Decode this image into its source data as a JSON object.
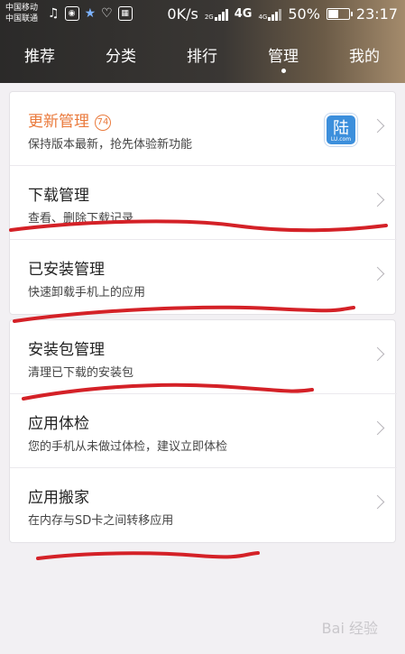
{
  "status_bar": {
    "carrier1": "中国移动",
    "carrier2": "中国联通",
    "network_speed": "0K/s",
    "net_2g": "2G",
    "net_4g": "4G",
    "net_4g_small": "4G",
    "battery": "50%",
    "time": "23:17"
  },
  "tabs": [
    {
      "label": "推荐"
    },
    {
      "label": "分类"
    },
    {
      "label": "排行"
    },
    {
      "label": "管理"
    },
    {
      "label": "我的"
    }
  ],
  "cards": [
    {
      "rows": [
        {
          "title": "更新管理",
          "badge": "74",
          "subtitle": "保持版本最新，抢先体验新功能"
        },
        {
          "title": "下载管理",
          "subtitle": "查看、删除下载记录"
        },
        {
          "title": "已安装管理",
          "subtitle": "快速卸载手机上的应用"
        }
      ]
    },
    {
      "rows": [
        {
          "title": "安装包管理",
          "subtitle": "清理已下载的安装包"
        },
        {
          "title": "应用体检",
          "subtitle": "您的手机从未做过体检，建议立即体检"
        },
        {
          "title": "应用搬家",
          "subtitle": "在内存与SD卡之间转移应用"
        }
      ]
    }
  ],
  "app_thumb": {
    "glyph": "陆",
    "caption": "LU.com"
  },
  "watermark": "Bai 经验",
  "colors": {
    "accent": "#ea7a3c",
    "scribble": "#d42127"
  }
}
